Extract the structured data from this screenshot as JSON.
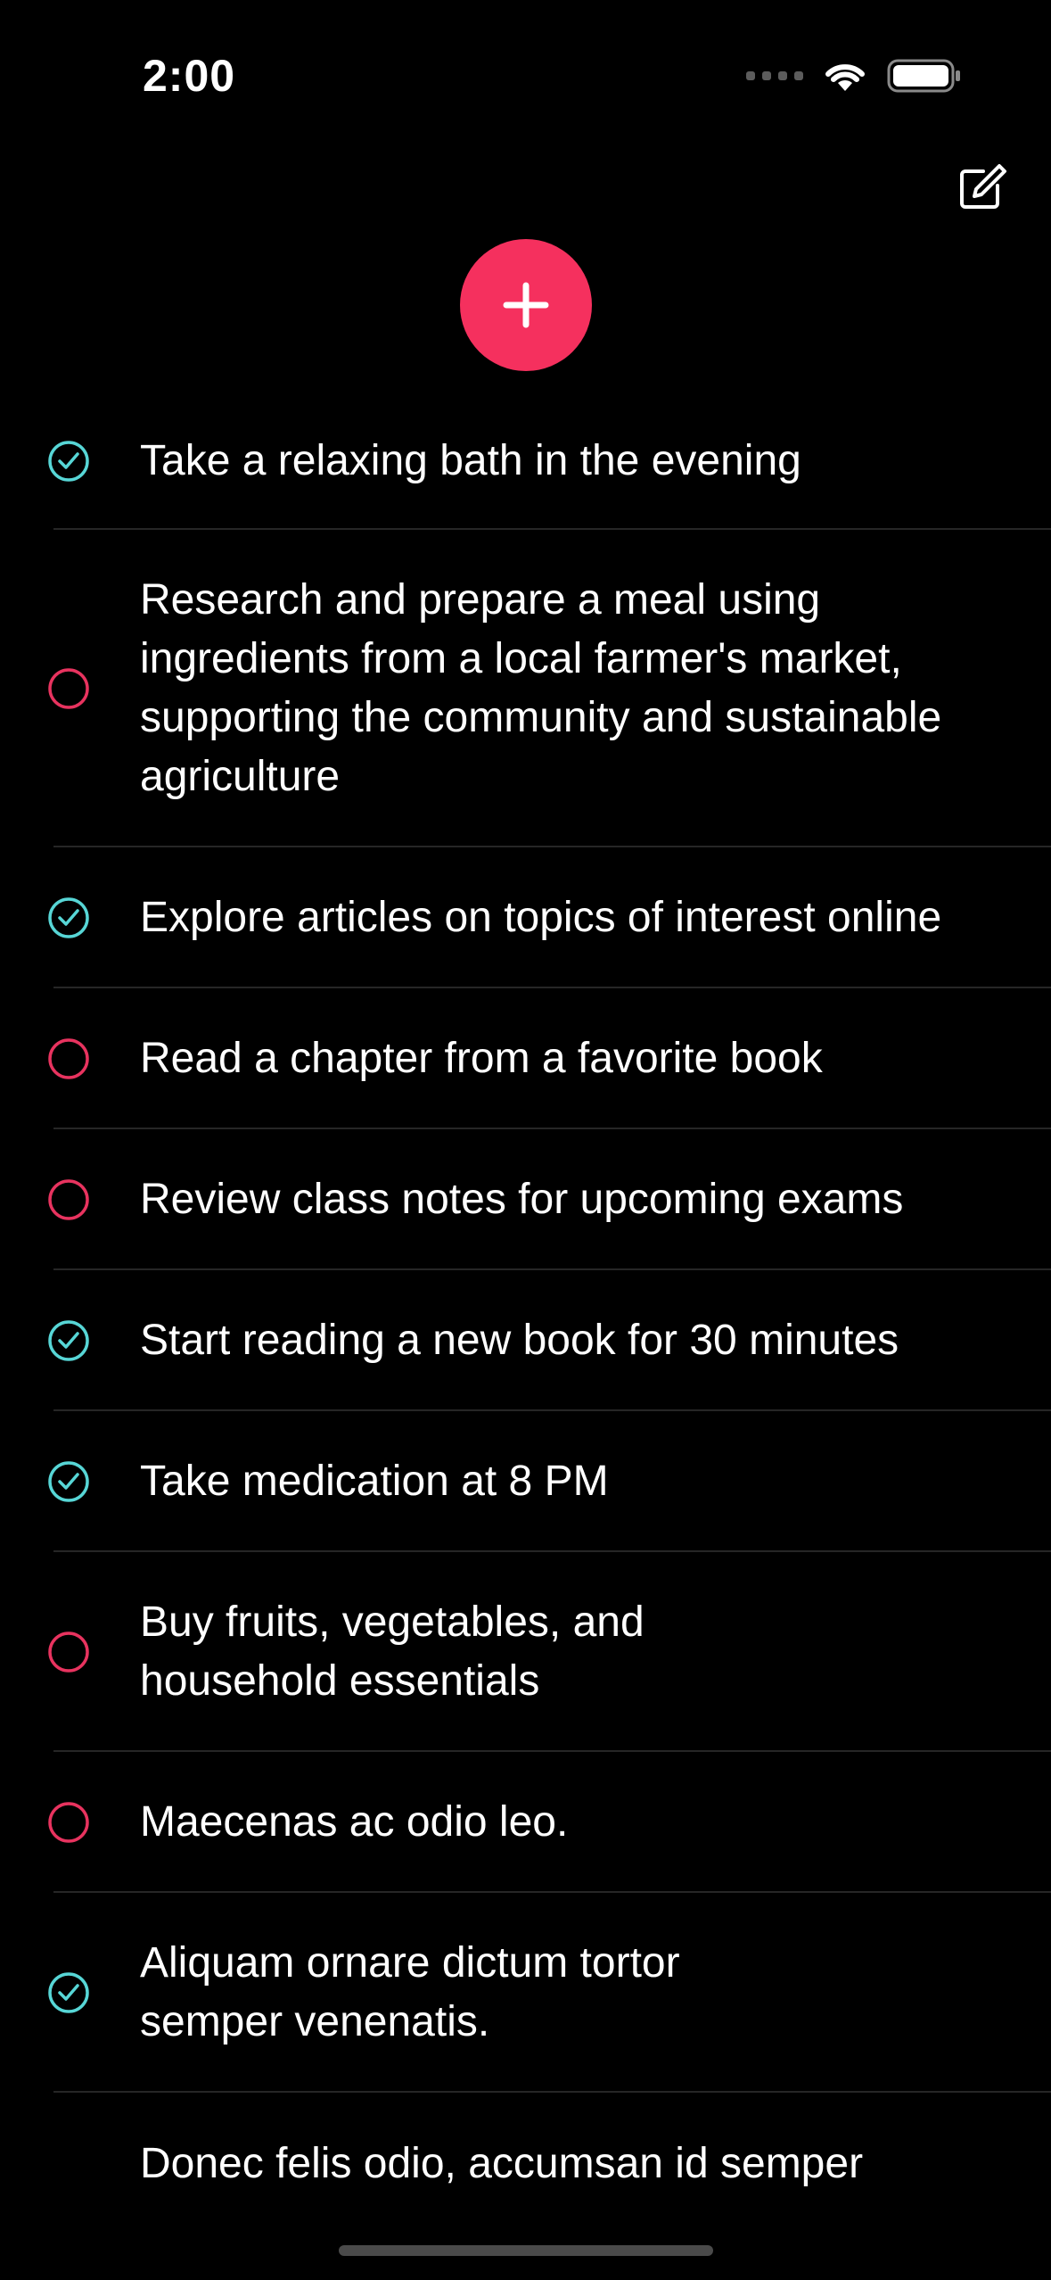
{
  "status_bar": {
    "time": "2:00"
  },
  "colors": {
    "accent": "#f5305e",
    "done": "#57d6d6",
    "pending": "#e8335f",
    "background": "#000000"
  },
  "icons": {
    "compose": "compose-icon",
    "add": "plus-icon",
    "done": "check-circle-icon",
    "pending": "empty-circle-icon"
  },
  "tasks": [
    {
      "text": "Take a relaxing bath in the evening",
      "done": true
    },
    {
      "text": "Research and prepare a meal using ingredients from a local farmer's market, supporting the community and sustainable agriculture",
      "done": false
    },
    {
      "text": "Explore articles on topics of interest online",
      "done": true
    },
    {
      "text": "Read a chapter from a favorite book",
      "done": false
    },
    {
      "text": "Review class notes for upcoming exams",
      "done": false
    },
    {
      "text": "Start reading a new book for 30 minutes",
      "done": true
    },
    {
      "text": "Take medication at 8 PM",
      "done": true
    },
    {
      "text": "Buy fruits, vegetables, and household essentials",
      "done": false
    },
    {
      "text": "Maecenas ac odio leo.",
      "done": false
    },
    {
      "text": "Aliquam ornare dictum tortor semper venenatis.",
      "done": true
    },
    {
      "text": "Donec felis odio, accumsan id semper",
      "done": null
    }
  ]
}
